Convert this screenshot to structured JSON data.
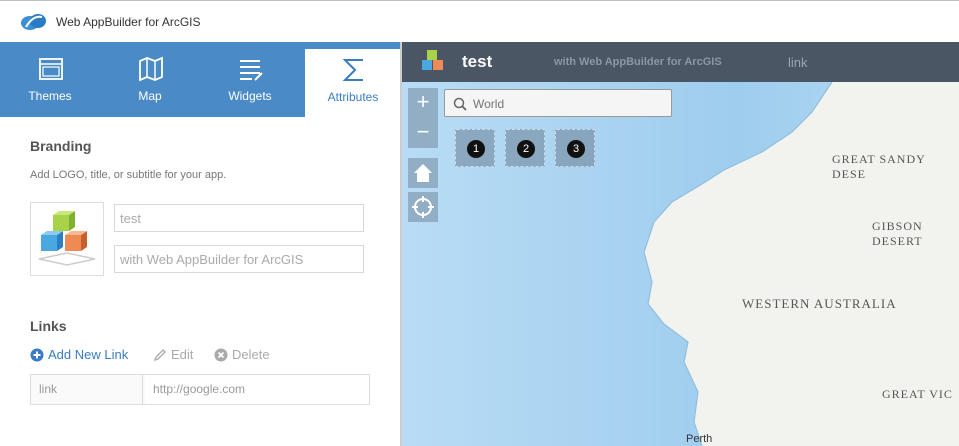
{
  "app": {
    "title": "Web AppBuilder for ArcGIS"
  },
  "tabs": [
    {
      "label": "Themes",
      "icon": "themes-icon"
    },
    {
      "label": "Map",
      "icon": "map-icon"
    },
    {
      "label": "Widgets",
      "icon": "widgets-icon"
    },
    {
      "label": "Attributes",
      "icon": "sigma-icon",
      "active": true
    }
  ],
  "branding": {
    "title": "Branding",
    "hint": "Add LOGO, title, or subtitle for your app.",
    "title_value": "test",
    "subtitle_value": "with Web AppBuilder for ArcGIS"
  },
  "links": {
    "title": "Links",
    "add_label": "Add New Link",
    "edit_label": "Edit",
    "delete_label": "Delete",
    "rows": [
      {
        "label": "link",
        "url": "http://google.com"
      }
    ]
  },
  "map_header": {
    "title": "test",
    "subtitle": "with Web AppBuilder for ArcGIS",
    "link": "link"
  },
  "map": {
    "search_placeholder": "World",
    "zoom_in": "+",
    "zoom_out": "−",
    "placeholders": [
      "1",
      "2",
      "3"
    ],
    "labels": {
      "sandy": "GREAT SANDY DESE",
      "gibson1": "GIBSON",
      "gibson2": "DESERT",
      "wa": "WESTERN AUSTRALIA",
      "vic": "GREAT VIC",
      "perth": "Perth"
    }
  },
  "colors": {
    "tab_bar": "#4a8ac6",
    "map_header": "#4a5663",
    "ocean": "#a9d3f0",
    "land": "#f2f2ee"
  }
}
